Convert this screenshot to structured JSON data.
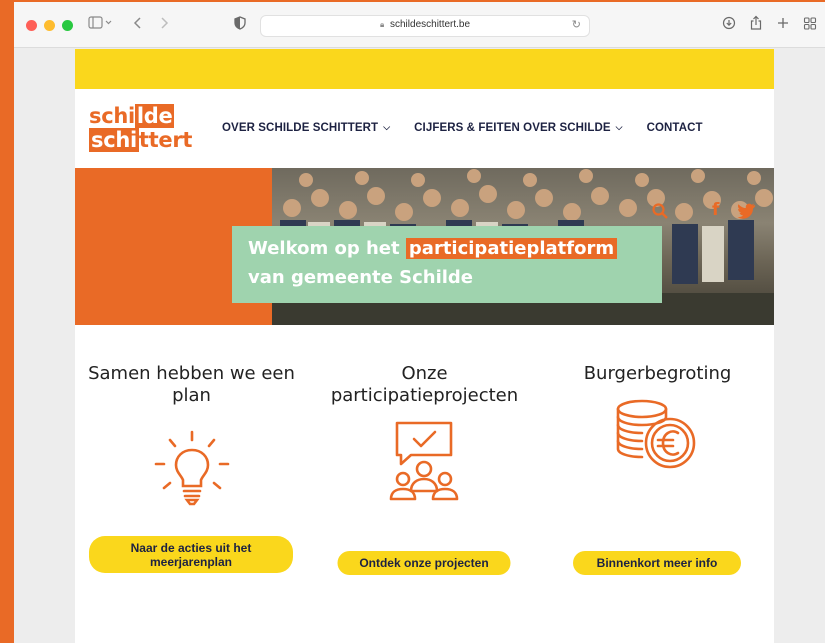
{
  "browser": {
    "url": "schildeschittert.be",
    "icons": {
      "sidebar": "sidebar-icon",
      "back": "chevron-left-icon",
      "forward": "chevron-right-icon",
      "shield": "shield-icon",
      "reload": "reload-icon",
      "download": "download-icon",
      "share": "share-icon",
      "new_tab": "plus-icon",
      "tabs": "tab-overview-icon"
    }
  },
  "logo": {
    "line1_a": "schi",
    "line1_b": "lde",
    "line2_a": "schi",
    "line2_b": "ttert"
  },
  "nav": {
    "items": [
      {
        "label": "OVER SCHILDE SCHITTERT",
        "has_dropdown": true
      },
      {
        "label": "CIJFERS & FEITEN OVER SCHILDE",
        "has_dropdown": true
      },
      {
        "label": "CONTACT",
        "has_dropdown": false
      }
    ]
  },
  "hero": {
    "line1_prefix": "Welkom op het",
    "line1_highlight": "participatieplatform",
    "line2": "van gemeente Schilde"
  },
  "columns": [
    {
      "title": "Samen hebben we een plan",
      "icon": "lightbulb-icon",
      "button": "Naar de acties uit het meerjarenplan"
    },
    {
      "title": "Onze participatieprojecten",
      "icon": "group-chat-icon",
      "button": "Ontdek onze projecten"
    },
    {
      "title": "Burgerbegroting",
      "icon": "euro-coins-icon",
      "button": "Binnenkort meer info"
    }
  ],
  "colors": {
    "orange": "#e96a26",
    "yellow": "#fad71c",
    "green": "#9fd3ae",
    "navy": "#1d2242"
  }
}
